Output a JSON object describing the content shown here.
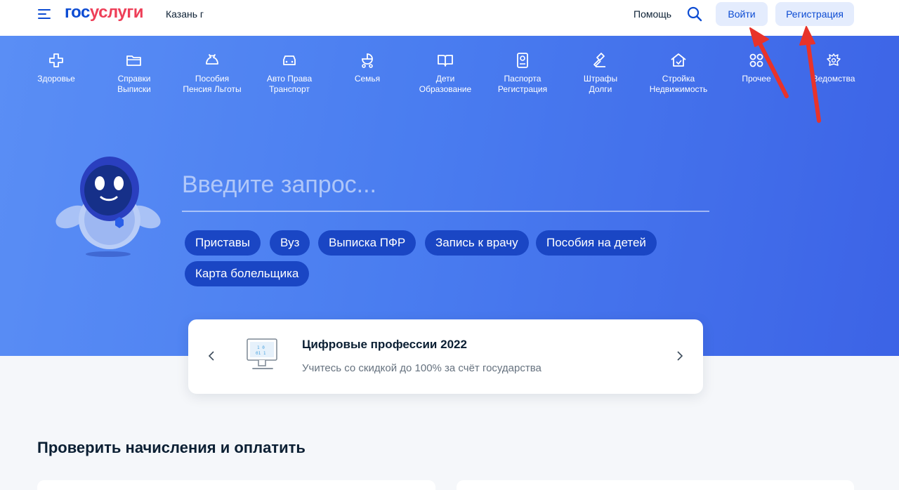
{
  "header": {
    "logo_part1": "гос",
    "logo_part2": "услуги",
    "city": "Казань г",
    "help": "Помощь",
    "login": "Войти",
    "register": "Регистрация"
  },
  "categories": [
    {
      "label": "Здоровье",
      "icon": "plus-cross-icon"
    },
    {
      "label": "Справки\nВыписки",
      "icon": "folder-icon"
    },
    {
      "label": "Пособия\nПенсия Льготы",
      "icon": "money-bag-icon"
    },
    {
      "label": "Авто Права\nТранспорт",
      "icon": "car-icon"
    },
    {
      "label": "Семья",
      "icon": "stroller-icon"
    },
    {
      "label": "Дети\nОбразование",
      "icon": "book-icon"
    },
    {
      "label": "Паспорта\nРегистрация",
      "icon": "passport-icon"
    },
    {
      "label": "Штрафы\nДолги",
      "icon": "gavel-icon"
    },
    {
      "label": "Стройка\nНедвижимость",
      "icon": "house-icon"
    },
    {
      "label": "Прочее",
      "icon": "grid-icon"
    },
    {
      "label": "Ведомства",
      "icon": "emblem-icon"
    }
  ],
  "search": {
    "placeholder": "Введите запрос..."
  },
  "chips": [
    "Приставы",
    "Вуз",
    "Выписка ПФР",
    "Запись к врачу",
    "Пособия на детей",
    "Карта болельщика"
  ],
  "promo": {
    "title": "Цифровые профессии 2022",
    "subtitle": "Учитесь со скидкой до 100% за счёт государства"
  },
  "section": {
    "title": "Проверить начисления и оплатить"
  },
  "colors": {
    "brand_blue": "#0d4cd3",
    "brand_red": "#ee3f58",
    "hero_blue": "#4a7df0",
    "chip_blue": "#1a46c4",
    "annotation_red": "#e8332a"
  }
}
